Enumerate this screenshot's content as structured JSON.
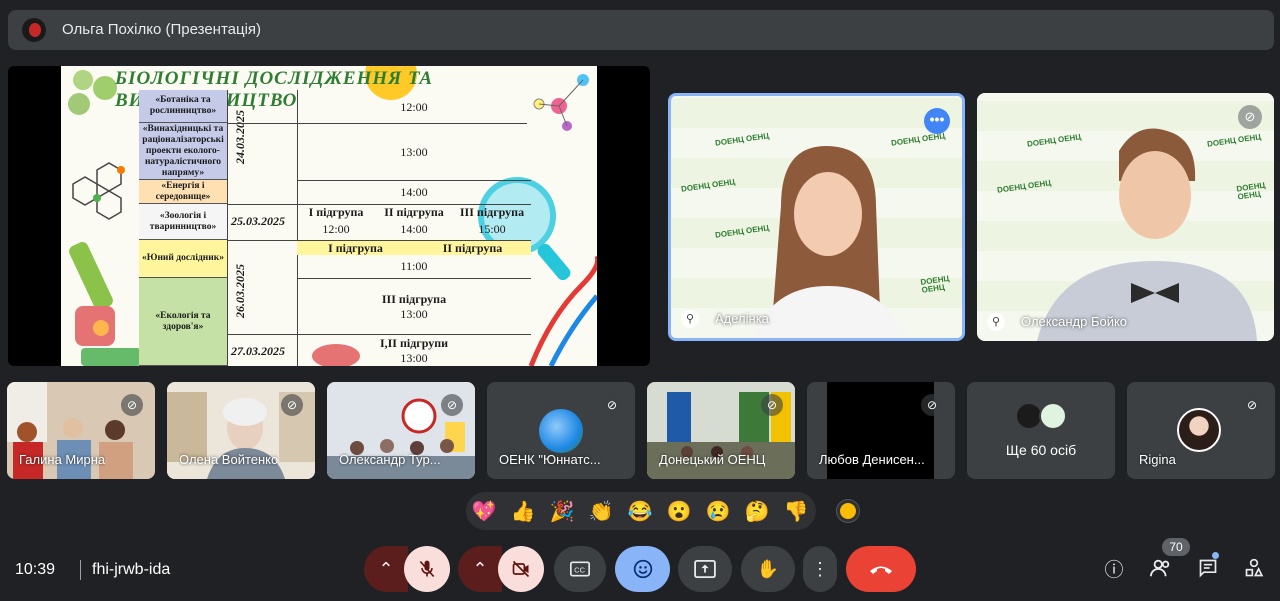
{
  "topbar": {
    "presenter_title": "Ольга Похілко (Презентація)"
  },
  "slide": {
    "title": "БІОЛОГІЧНІ ДОСЛІДЖЕННЯ ТА ВИНАХІДНИЦТВО",
    "categories": [
      "«Ботаніка та рослинництво»",
      "«Винахідницькі та раціоналізаторські проекти еколого-натуралістичного напряму»",
      "«Енергія і середовище»",
      "«Зоологія і тваринництво»",
      "«Юний дослідник»",
      "«Екологія та здоров'я»"
    ],
    "dates": [
      "24.03.2025",
      "25.03.2025",
      "26.03.2025",
      "27.03.2025"
    ],
    "times": {
      "t1": "12:00",
      "t2": "13:00",
      "t3": "14:00",
      "g1": "I підгрупа",
      "g2": "II підгрупа",
      "g3": "III підгрупа",
      "g1t": "12:00",
      "g2t": "14:00",
      "g3t": "15:00",
      "ya": "I підгрупа",
      "yb": "II підгрупа",
      "yt": "11:00",
      "e3": "III підгрупа",
      "e3t": "13:00",
      "e12": "I,II підгрупи",
      "e12t": "13:00"
    }
  },
  "tiles": {
    "big1": {
      "name": "Аделінка",
      "logo": "DOEHЦ ОЕНЦ"
    },
    "big2": {
      "name": "Олександр Бойко",
      "logo": "DOEHЦ ОЕНЦ"
    }
  },
  "small_tiles": [
    {
      "name": "Галина Мирна"
    },
    {
      "name": "Олена Войтенко"
    },
    {
      "name": "Олександр Тур..."
    },
    {
      "name": "ОЕНК \"Юннатс..."
    },
    {
      "name": "Донецький ОЕНЦ"
    },
    {
      "name": "Любов Денисен..."
    },
    {
      "name": "Ще 60 осіб"
    },
    {
      "name": "Rigina"
    }
  ],
  "reactions": [
    "💖",
    "👍",
    "🎉",
    "👏",
    "😂",
    "😮",
    "😢",
    "🤔",
    "👎"
  ],
  "bottom": {
    "clock": "10:39",
    "meeting_code": "fhi-jrwb-ida",
    "participants_count": "70"
  },
  "icons": {
    "mic_off": "mic-off-icon",
    "cam_off": "camera-off-icon",
    "captions": "captions-icon",
    "emoji": "emoji-icon",
    "present": "present-screen-icon",
    "hand": "raise-hand-icon",
    "more": "more-vert-icon",
    "hangup": "hangup-icon",
    "info": "info-icon",
    "people": "people-icon",
    "chat": "chat-icon",
    "activities": "activities-icon"
  },
  "colors": {
    "background": "#202124",
    "hangup": "#ea4335",
    "active_blue": "#8ab4f8",
    "speaker_border": "#8ab4f8"
  }
}
